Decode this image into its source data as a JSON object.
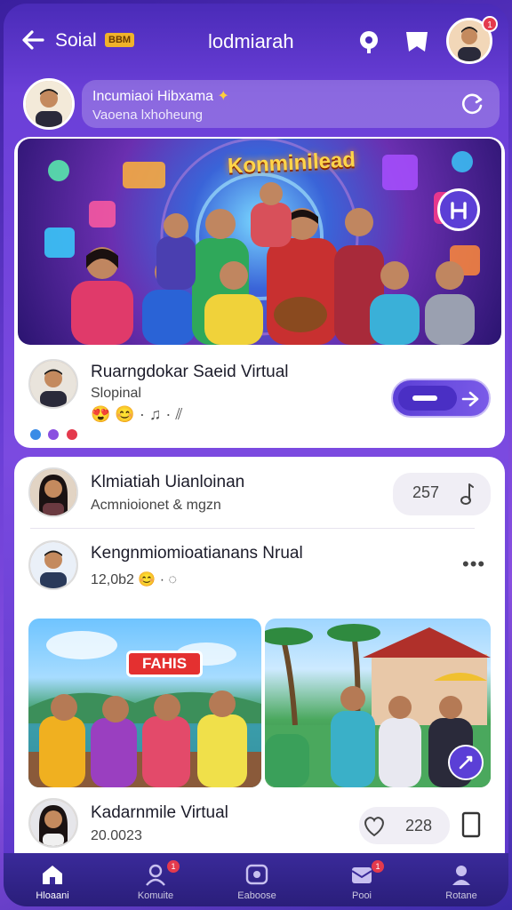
{
  "topbar": {
    "app_name": "Soial",
    "app_badge": "BBM",
    "title": "lodmiarah",
    "notification_count": "1"
  },
  "search": {
    "title": "Incumiaoi Hibxama",
    "title_icon": "✦",
    "subtitle": "Vaoena lxhoheung"
  },
  "hero": {
    "banner_text": "Konminilead",
    "title": "Ruarngdokar Saeid Virtual",
    "subtitle": "Slopinal",
    "reactions": "😍 😊 · ♫ · ⫽",
    "dot_colors": [
      "#3a8be6",
      "#8a4fe0",
      "#e43a4d"
    ]
  },
  "feed": {
    "row1": {
      "title": "Klmiatiah Uianloinan",
      "subtitle": "Acmnioionet & mgzn",
      "count": "257"
    },
    "row2": {
      "title": "Kengnmiomioatianans Nrual",
      "subtitle": "12,0b2 😊 · ◌",
      "more": "•••"
    },
    "photo_badge": "FAHIS",
    "row3": {
      "title": "Kadarnmile Virtual",
      "subtitle": "20.0023",
      "count": "228"
    }
  },
  "nav": [
    {
      "label": "Hloaani",
      "active": true,
      "icon": "home-icon"
    },
    {
      "label": "Komuite",
      "active": false,
      "icon": "community-icon",
      "badge": "1"
    },
    {
      "label": "Eaboose",
      "active": false,
      "icon": "media-icon"
    },
    {
      "label": "Pooi",
      "active": false,
      "icon": "inbox-icon",
      "badge": "1"
    },
    {
      "label": "Rotane",
      "active": false,
      "icon": "profile-icon"
    }
  ],
  "colors": {
    "accent": "#5b3fd6",
    "badge": "#e43a4d",
    "banner_yellow": "#ffd54a"
  }
}
